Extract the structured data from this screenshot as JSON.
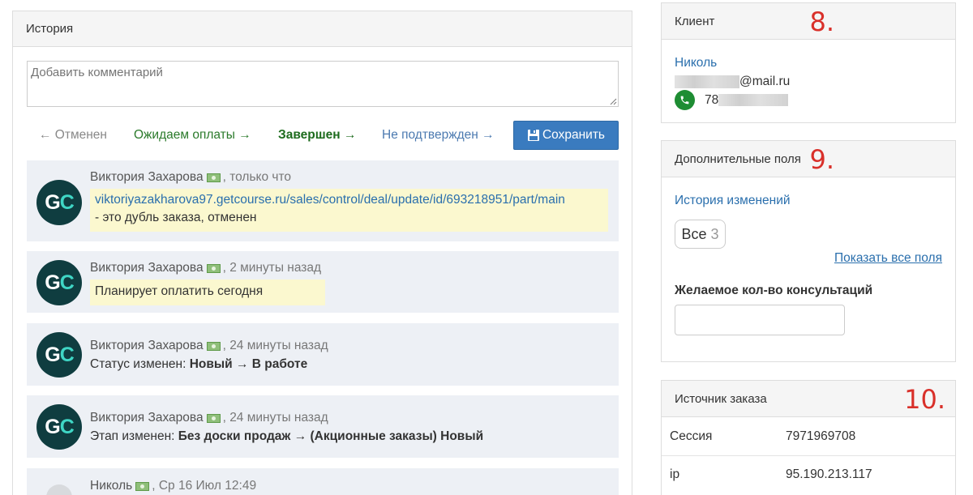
{
  "history": {
    "title": "История",
    "comment_placeholder": "Добавить комментарий",
    "statuses": {
      "cancel": "← Отменен",
      "wait": "Ожидаем оплаты →",
      "done": "Завершен →",
      "unconfirmed": "Не подтвержден →"
    },
    "save_label": "Сохранить",
    "entries": [
      {
        "author": "Виктория Захарова",
        "time": ", только что",
        "link": "viktoriyazakharova97.getcourse.ru/sales/control/deal/update/id/693218951/part/main",
        "text": "- это дубль заказа, отменен"
      },
      {
        "author": "Виктория Захарова",
        "time": ", 2 минуты назад",
        "text": "Планирует оплатить сегодня"
      },
      {
        "author": "Виктория Захарова",
        "time": ", 24 минуты назад",
        "prefix": "Статус изменен: ",
        "bold": "Новый → В работе"
      },
      {
        "author": "Виктория Захарова",
        "time": ", 24 минуты назад",
        "prefix": "Этап изменен: ",
        "bold": "Без доски продаж → (Акционные заказы) Новый"
      },
      {
        "author": "Николь",
        "time": ", Ср 16 Июл 12:49"
      }
    ],
    "avatar_text_g": "G",
    "avatar_text_c": "C"
  },
  "client": {
    "title": "Клиент",
    "marker": "8.",
    "name": "Николь",
    "email_domain": "@mail.ru",
    "phone_prefix": "78"
  },
  "extra": {
    "title": "Дополнительные поля",
    "marker": "9.",
    "history_link": "История изменений",
    "all_label": "Все",
    "all_count": "3",
    "show_all": "Показать все поля",
    "field_label": "Желаемое кол-во консультаций"
  },
  "source": {
    "title": "Источник заказа",
    "marker": "10.",
    "rows": [
      {
        "key": "Сессия",
        "value": "7971969708"
      },
      {
        "key": "ip",
        "value": "95.190.213.117"
      }
    ]
  },
  "colors": {
    "marker_red": "#d9302a",
    "save_blue": "#3a7bbf",
    "link_blue": "#2a6fad",
    "note_yellow": "#fbf8cf",
    "entry_bg": "#edf0f5"
  }
}
